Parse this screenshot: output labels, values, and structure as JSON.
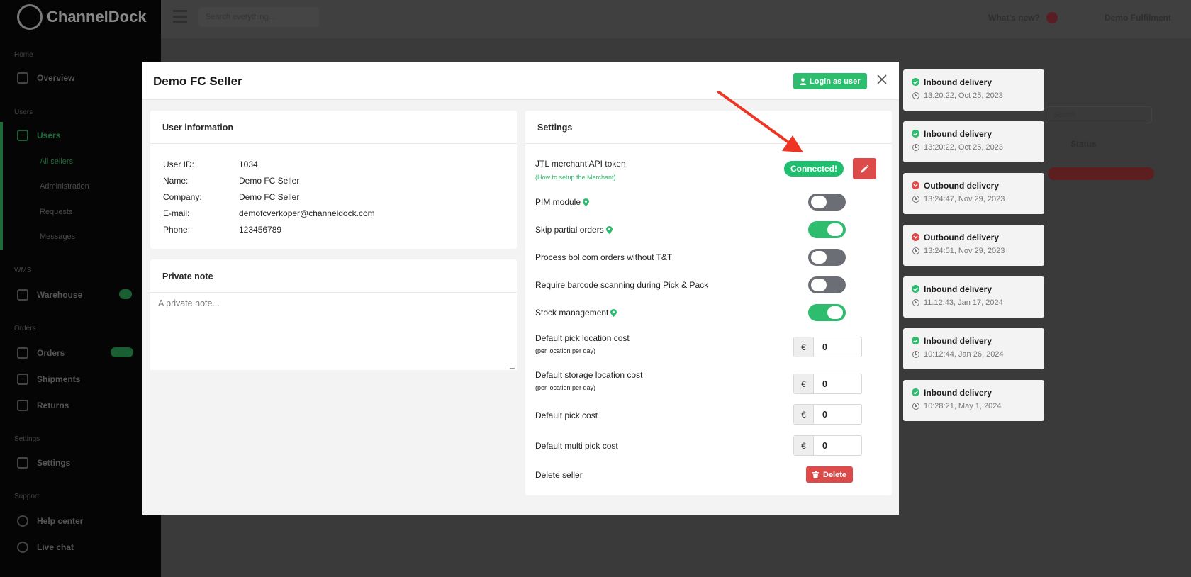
{
  "background": {
    "logo_text": "ChannelDock",
    "search_placeholder": "Search everything...",
    "whats_new": "What's new?",
    "account": "Demo Fulfilment",
    "sections": [
      {
        "label": "Home"
      },
      {
        "label": "Users"
      },
      {
        "label": "WMS"
      },
      {
        "label": "Orders"
      },
      {
        "label": "Settings"
      },
      {
        "label": "Support"
      }
    ],
    "items": [
      {
        "label": "Overview"
      },
      {
        "label": "Users"
      },
      {
        "label": "Warehouse"
      },
      {
        "label": "Orders"
      },
      {
        "label": "Shipments"
      },
      {
        "label": "Returns"
      },
      {
        "label": "Settings"
      },
      {
        "label": "Help center"
      },
      {
        "label": "Live chat"
      }
    ],
    "subitems": [
      {
        "label": "All sellers"
      },
      {
        "label": "Administration"
      },
      {
        "label": "Requests"
      },
      {
        "label": "Messages"
      }
    ],
    "panel_search": "Search",
    "panel_status": "Status"
  },
  "modal": {
    "title": "Demo FC Seller",
    "login_label": "Login as user",
    "user_info": {
      "header": "User information",
      "rows": [
        {
          "label": "User ID:",
          "value": "1034"
        },
        {
          "label": "Name:",
          "value": "Demo FC Seller"
        },
        {
          "label": "Company:",
          "value": "Demo FC Seller"
        },
        {
          "label": "E-mail:",
          "value": "demofcverkoper@channeldock.com"
        },
        {
          "label": "Phone:",
          "value": "123456789"
        }
      ]
    },
    "private_note": {
      "header": "Private note",
      "placeholder": "A private note..."
    },
    "settings": {
      "header": "Settings",
      "api_token_label": "JTL merchant API token",
      "api_help_link": "(How to setup the Merchant)",
      "connected_label": "Connected!",
      "toggles": [
        {
          "label": "PIM module",
          "on": false,
          "pin": true
        },
        {
          "label": "Skip partial orders",
          "on": true,
          "pin": true
        },
        {
          "label": "Process bol.com orders without T&T",
          "on": false,
          "pin": false
        },
        {
          "label": "Require barcode scanning during Pick & Pack",
          "on": false,
          "pin": false
        },
        {
          "label": "Stock management",
          "on": true,
          "pin": true
        }
      ],
      "costs": [
        {
          "label": "Default pick location cost",
          "sub": "(per location per day)",
          "currency": "€",
          "value": "0"
        },
        {
          "label": "Default storage location cost",
          "sub": "(per location per day)",
          "currency": "€",
          "value": "0"
        },
        {
          "label": "Default pick cost",
          "sub": "",
          "currency": "€",
          "value": "0"
        },
        {
          "label": "Default multi pick cost",
          "sub": "",
          "currency": "€",
          "value": "0"
        }
      ],
      "delete_label": "Delete seller",
      "delete_button": "Delete"
    }
  },
  "notifications": [
    {
      "title": "Inbound delivery",
      "time": "13:20:22, Oct 25, 2023",
      "status": "ok"
    },
    {
      "title": "Inbound delivery",
      "time": "13:20:22, Oct 25, 2023",
      "status": "ok"
    },
    {
      "title": "Outbound delivery",
      "time": "13:24:47, Nov 29, 2023",
      "status": "error"
    },
    {
      "title": "Outbound delivery",
      "time": "13:24:51, Nov 29, 2023",
      "status": "error"
    },
    {
      "title": "Inbound delivery",
      "time": "11:12:43, Jan 17, 2024",
      "status": "ok"
    },
    {
      "title": "Inbound delivery",
      "time": "10:12:44, Jan 26, 2024",
      "status": "ok"
    },
    {
      "title": "Inbound delivery",
      "time": "10:28:21, May 1, 2024",
      "status": "ok"
    }
  ],
  "colors": {
    "accent_green": "#2ebd6f",
    "danger_red": "#dc4b49",
    "annotation_arrow": "#ee3524"
  }
}
